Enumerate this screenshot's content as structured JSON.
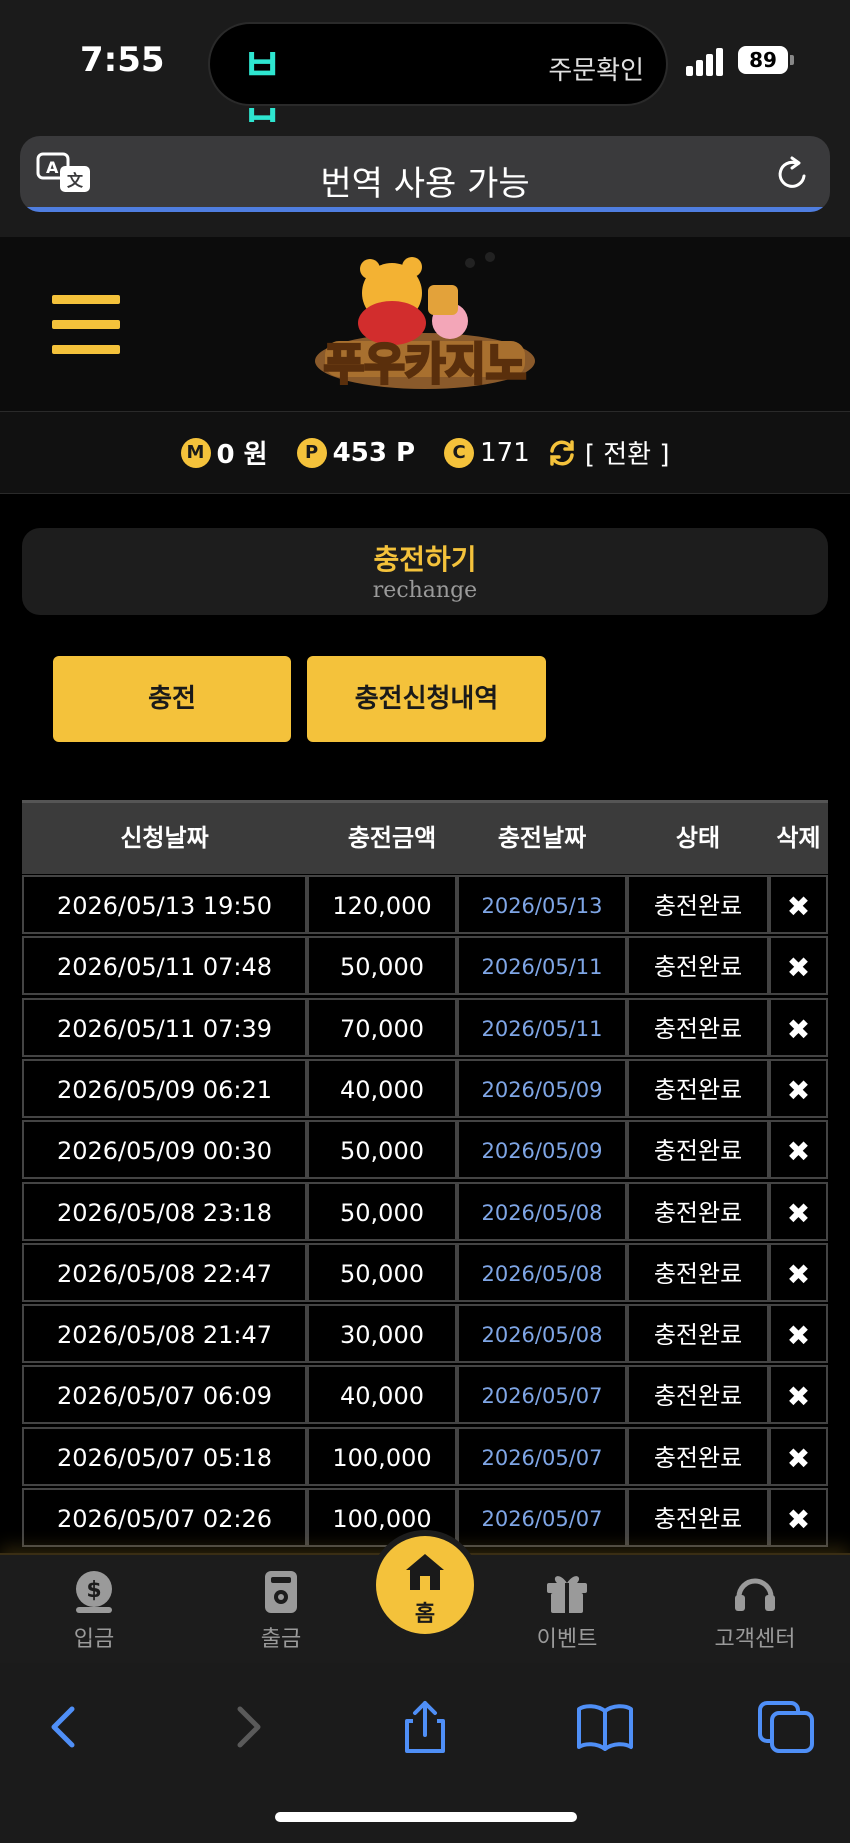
{
  "status_bar": {
    "time": "7:55",
    "island_app": "ㅂㅂ",
    "island_text": "주문확인",
    "battery": "89"
  },
  "url_bar": {
    "text": "번역 사용 가능"
  },
  "balance": {
    "m_badge": "M",
    "m_value": "0 원",
    "p_badge": "P",
    "p_value": "453 P",
    "c_badge": "C",
    "c_value": "171",
    "swap_label": "[ 전환 ]"
  },
  "logo_text": "푸우카지노",
  "section": {
    "title": "충전하기",
    "subtitle": "rechange"
  },
  "buttons": {
    "charge": "충전",
    "history": "충전신청내역"
  },
  "table": {
    "headers": [
      "신청날짜",
      "충전금액",
      "충전날짜",
      "상태",
      "삭제"
    ],
    "delete_glyph": "✖",
    "rows": [
      {
        "requested": "2026/05/13 19:50",
        "amount": "120,000",
        "charged": "2026/05/13",
        "status": "충전완료"
      },
      {
        "requested": "2026/05/11 07:48",
        "amount": "50,000",
        "charged": "2026/05/11",
        "status": "충전완료"
      },
      {
        "requested": "2026/05/11 07:39",
        "amount": "70,000",
        "charged": "2026/05/11",
        "status": "충전완료"
      },
      {
        "requested": "2026/05/09 06:21",
        "amount": "40,000",
        "charged": "2026/05/09",
        "status": "충전완료"
      },
      {
        "requested": "2026/05/09 00:30",
        "amount": "50,000",
        "charged": "2026/05/09",
        "status": "충전완료"
      },
      {
        "requested": "2026/05/08 23:18",
        "amount": "50,000",
        "charged": "2026/05/08",
        "status": "충전완료"
      },
      {
        "requested": "2026/05/08 22:47",
        "amount": "50,000",
        "charged": "2026/05/08",
        "status": "충전완료"
      },
      {
        "requested": "2026/05/08 21:47",
        "amount": "30,000",
        "charged": "2026/05/08",
        "status": "충전완료"
      },
      {
        "requested": "2026/05/07 06:09",
        "amount": "40,000",
        "charged": "2026/05/07",
        "status": "충전완료"
      },
      {
        "requested": "2026/05/07 05:18",
        "amount": "100,000",
        "charged": "2026/05/07",
        "status": "충전완료"
      },
      {
        "requested": "2026/05/07 02:26",
        "amount": "100,000",
        "charged": "2026/05/07",
        "status": "충전완료"
      }
    ]
  },
  "tabbar": {
    "deposit": "입금",
    "withdraw": "출금",
    "home": "홈",
    "event": "이벤트",
    "support": "고객센터"
  },
  "colors": {
    "accent": "#f4c23b",
    "link_blue": "#7fa6e6",
    "background": "#000000"
  },
  "icons": {
    "toolbar": [
      "back-icon",
      "forward-icon",
      "share-icon",
      "bookmarks-icon",
      "tabs-icon"
    ]
  }
}
